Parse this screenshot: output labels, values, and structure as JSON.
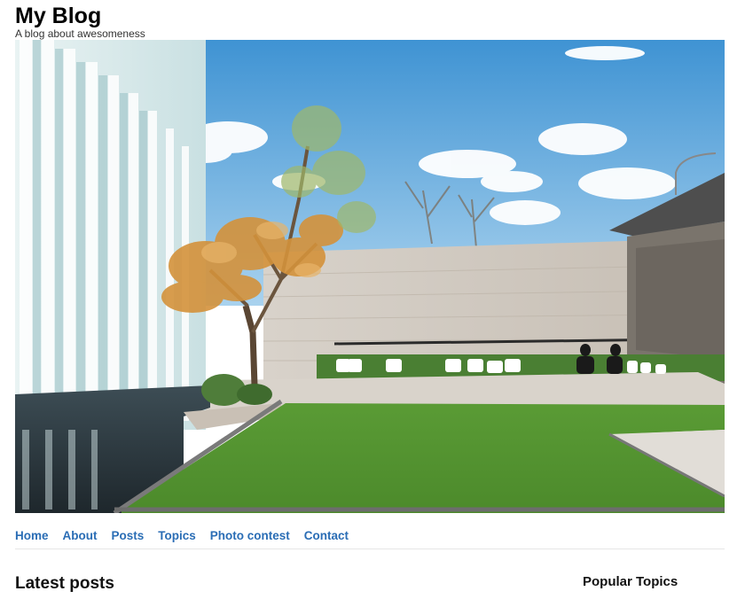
{
  "site": {
    "title": "My Blog",
    "tagline": "A blog about awesomeness"
  },
  "hero": {
    "alt": "Modern courtyard with a tree, lawn, reflecting pool and seating"
  },
  "nav": {
    "items": [
      {
        "label": "Home"
      },
      {
        "label": "About"
      },
      {
        "label": "Posts"
      },
      {
        "label": "Topics"
      },
      {
        "label": "Photo contest"
      },
      {
        "label": "Contact"
      }
    ]
  },
  "main": {
    "latest_heading": "Latest posts"
  },
  "sidebar": {
    "popular_heading": "Popular Topics"
  },
  "colors": {
    "link": "#2a6db5",
    "sky": "#5aa6d8",
    "lawn": "#5f9e3a"
  }
}
